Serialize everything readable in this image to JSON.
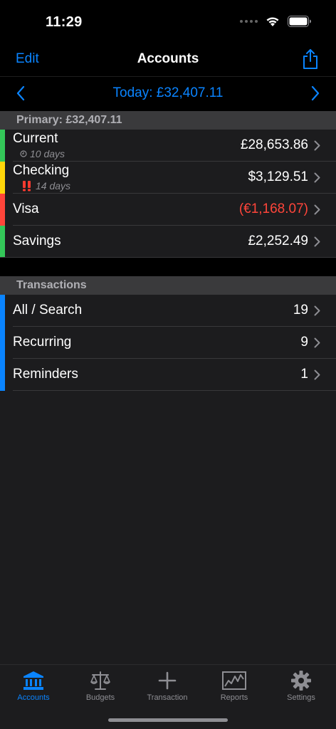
{
  "status": {
    "time": "11:29"
  },
  "nav": {
    "edit_label": "Edit",
    "title": "Accounts",
    "share_icon": "share-icon"
  },
  "date_bar": {
    "label": "Today: £32,407.11"
  },
  "accounts": {
    "header": "Primary: £32,407.11",
    "items": [
      {
        "name": "Current",
        "subtitle": "10 days",
        "subtitle_icon": "clock-icon",
        "value": "£28,653.86",
        "bar_color": "#34c759"
      },
      {
        "name": "Checking",
        "subtitle": "14 days",
        "subtitle_icon": "double-exclamation-icon",
        "value": "$3,129.51",
        "bar_color": "#ffd60a"
      },
      {
        "name": "Visa",
        "value": "(€1,168.07)",
        "bar_color": "#ff453a",
        "value_color": "#ff453a"
      },
      {
        "name": "Savings",
        "value": "£2,252.49",
        "bar_color": "#34c759"
      }
    ]
  },
  "transactions": {
    "header": "Transactions",
    "items": [
      {
        "name": "All / Search",
        "value": "19",
        "bar_color": "#0a84ff"
      },
      {
        "name": "Recurring",
        "value": "9",
        "bar_color": "#0a84ff"
      },
      {
        "name": "Reminders",
        "value": "1",
        "bar_color": "#0a84ff"
      }
    ]
  },
  "tabs": [
    {
      "label": "Accounts",
      "icon": "bank-icon",
      "active": true
    },
    {
      "label": "Budgets",
      "icon": "scales-icon",
      "active": false
    },
    {
      "label": "Transaction",
      "icon": "plus-icon",
      "active": false
    },
    {
      "label": "Reports",
      "icon": "chart-icon",
      "active": false
    },
    {
      "label": "Settings",
      "icon": "gear-icon",
      "active": false
    }
  ],
  "colors": {
    "accent": "#0a84ff",
    "negative": "#ff453a",
    "green": "#34c759",
    "yellow": "#ffd60a"
  }
}
